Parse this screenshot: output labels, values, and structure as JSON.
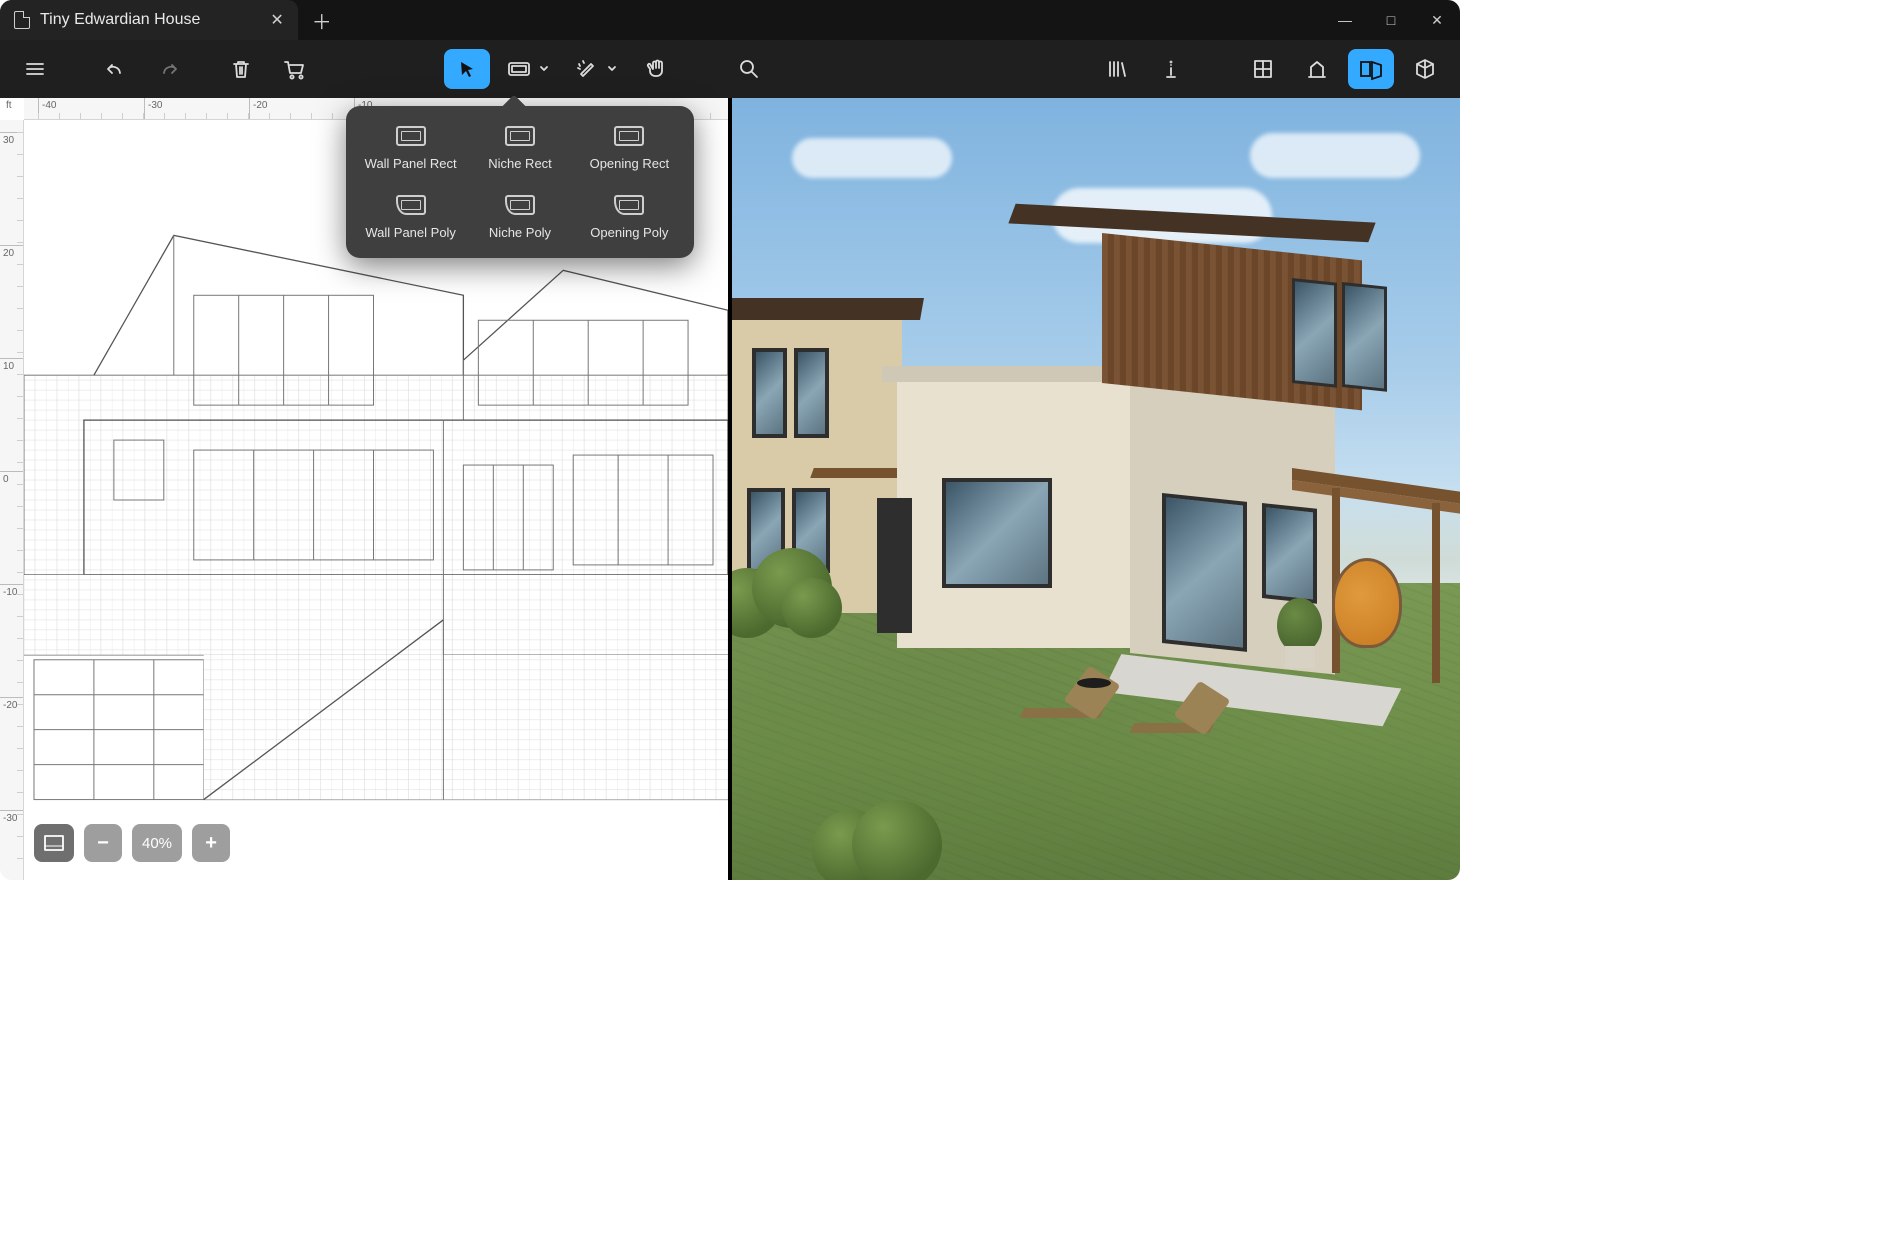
{
  "title_tab": "Tiny Edwardian House",
  "ruler_unit": "ft",
  "ruler_h_labels": [
    "-40",
    "-30",
    "-20",
    "-10"
  ],
  "ruler_v_labels": [
    "30",
    "20",
    "10",
    "0",
    "-10",
    "-20",
    "-30"
  ],
  "zoom_level": "40%",
  "toolbar_dropdown": {
    "items": [
      {
        "label": "Wall Panel Rect",
        "shape": "rect"
      },
      {
        "label": "Niche Rect",
        "shape": "rect"
      },
      {
        "label": "Opening Rect",
        "shape": "rect"
      },
      {
        "label": "Wall Panel Poly",
        "shape": "poly"
      },
      {
        "label": "Niche Poly",
        "shape": "poly"
      },
      {
        "label": "Opening Poly",
        "shape": "poly"
      }
    ]
  },
  "window_controls": {
    "min": "—",
    "max": "□",
    "close": "✕"
  },
  "tab_close": "✕",
  "new_tab": "＋",
  "zoom_minus": "−",
  "zoom_plus": "+"
}
